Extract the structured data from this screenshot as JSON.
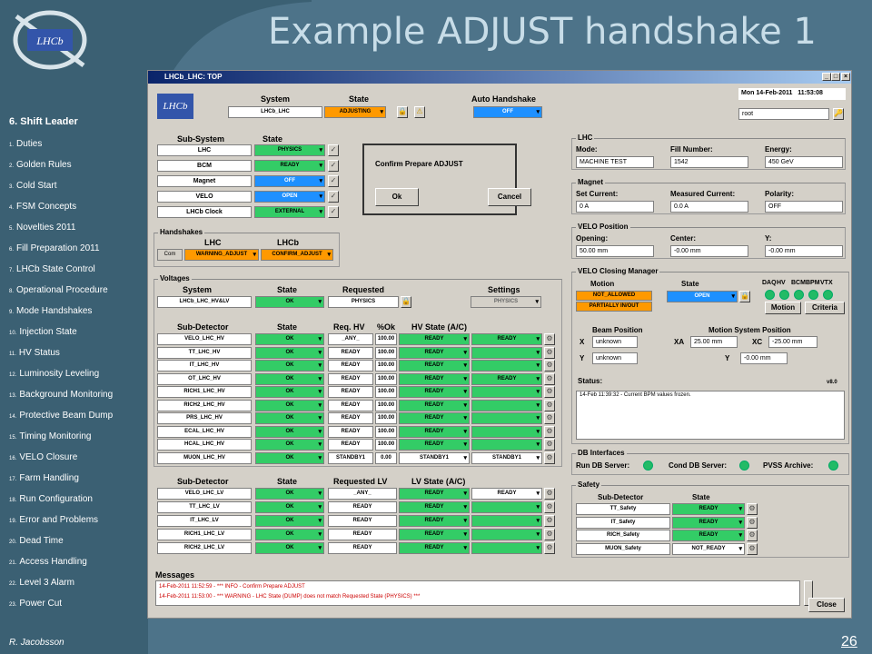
{
  "slide": {
    "title": "Example ADJUST handshake 1",
    "author": "R. Jacobsson",
    "page": "26"
  },
  "sidebar": {
    "title": "6. Shift Leader",
    "items": [
      {
        "num": "1.",
        "label": "Duties"
      },
      {
        "num": "2.",
        "label": "Golden Rules"
      },
      {
        "num": "3.",
        "label": "Cold Start"
      },
      {
        "num": "4.",
        "label": "FSM Concepts"
      },
      {
        "num": "5.",
        "label": "Novelties 2011"
      },
      {
        "num": "6.",
        "label": "Fill Preparation 2011"
      },
      {
        "num": "7.",
        "label": "LHCb State Control"
      },
      {
        "num": "8.",
        "label": "Operational Procedure"
      },
      {
        "num": "9.",
        "label": "Mode Handshakes"
      },
      {
        "num": "10.",
        "label": "Injection State"
      },
      {
        "num": "11.",
        "label": "HV Status"
      },
      {
        "num": "12.",
        "label": "Luminosity Leveling"
      },
      {
        "num": "13.",
        "label": "Background Monitoring"
      },
      {
        "num": "14.",
        "label": "Protective Beam Dump"
      },
      {
        "num": "15.",
        "label": "Timing Monitoring"
      },
      {
        "num": "16.",
        "label": "VELO Closure"
      },
      {
        "num": "17.",
        "label": "Farm Handling"
      },
      {
        "num": "18.",
        "label": "Run Configuration"
      },
      {
        "num": "19.",
        "label": "Error and Problems"
      },
      {
        "num": "20.",
        "label": "Dead Time"
      },
      {
        "num": "21.",
        "label": "Access Handling"
      },
      {
        "num": "22.",
        "label": "Level 3 Alarm"
      },
      {
        "num": "23.",
        "label": "Power Cut"
      }
    ]
  },
  "window": {
    "title": "LHCb_LHC: TOP",
    "min": "_",
    "max": "□",
    "close": "×"
  },
  "top": {
    "system_h": "System",
    "state_h": "State",
    "auto_h": "Auto Handshake",
    "system": "LHCb_LHC",
    "state": "ADJUSTING",
    "auto": "OFF",
    "date": "Mon 14-Feb-2011",
    "time": "11:53:08",
    "user": "root"
  },
  "subsystem": {
    "h1": "Sub-System",
    "h2": "State",
    "rows": [
      {
        "name": "LHC",
        "state": "PHYSICS"
      },
      {
        "name": "BCM",
        "state": "READY"
      },
      {
        "name": "Magnet",
        "state": "OFF"
      },
      {
        "name": "VELO",
        "state": "OPEN"
      },
      {
        "name": "LHCb Clock",
        "state": "EXTERNAL"
      }
    ]
  },
  "handshakes": {
    "title": "Handshakes",
    "lhc_h": "LHC",
    "lhcb_h": "LHCb",
    "row": "Com",
    "lhc": "WARNING_ADJUST",
    "lhcb": "CONFIRM_ADJUST"
  },
  "dialog": {
    "text": "Confirm Prepare ADJUST",
    "ok": "Ok",
    "cancel": "Cancel"
  },
  "lhc": {
    "title": "LHC",
    "mode_l": "Mode:",
    "fill_l": "Fill Number:",
    "energy_l": "Energy:",
    "mode": "MACHINE TEST",
    "fill": "1542",
    "energy": "450 GeV"
  },
  "magnet": {
    "title": "Magnet",
    "set_l": "Set Current:",
    "meas_l": "Measured Current:",
    "pol_l": "Polarity:",
    "set": "0 A",
    "meas": "0.0 A",
    "pol": "OFF"
  },
  "velopos": {
    "title": "VELO Position",
    "open_l": "Opening:",
    "center_l": "Center:",
    "y_l": "Y:",
    "open": "50.00 mm",
    "center": "-0.00 mm",
    "y": "-0.00 mm"
  },
  "veloclose": {
    "title": "VELO Closing Manager",
    "motion_h": "Motion",
    "state_h": "State",
    "m1": "NOT_ALLOWED",
    "m2": "PARTIALLY IN/OUT",
    "state": "OPEN",
    "leds": [
      "DAQ",
      "HV",
      "BCM",
      "BPM",
      "VTX"
    ],
    "motion_btn": "Motion",
    "criteria_btn": "Criteria",
    "beampos_h": "Beam Position",
    "motionsys_h": "Motion System Position",
    "x_l": "X",
    "y_l": "Y",
    "xa_l": "XA",
    "xc_l": "XC",
    "y2_l": "Y",
    "x": "unknown",
    "y": "unknown",
    "xa": "25.00 mm",
    "xc": "-25.00 mm",
    "y2": "-0.00 mm",
    "status_l": "Status:",
    "version": "v8.0",
    "status_msg": "14-Feb 11:39:32 - Current BPM values frozen."
  },
  "db": {
    "title": "DB Interfaces",
    "run": "Run DB Server:",
    "cond": "Cond DB Server:",
    "pvss": "PVSS Archive:"
  },
  "safety": {
    "title": "Safety",
    "h1": "Sub-Detector",
    "h2": "State",
    "rows": [
      {
        "name": "TT_Safety",
        "state": "READY"
      },
      {
        "name": "IT_Safety",
        "state": "READY"
      },
      {
        "name": "RICH_Safety",
        "state": "READY"
      },
      {
        "name": "MUON_Safety",
        "state": "NOT_READY"
      }
    ]
  },
  "voltages": {
    "title": "Voltages",
    "sys_h": "System",
    "state_h": "State",
    "req_h": "Requested",
    "set_h": "Settings",
    "sys": "LHCb_LHC_HV&LV",
    "state": "OK",
    "req": "PHYSICS",
    "set": "PHYSICS",
    "hv_h": [
      "Sub-Detector",
      "State",
      "Req. HV",
      "%Ok",
      "HV State (A/C)"
    ],
    "hv": [
      {
        "n": "VELO_LHC_HV",
        "s": "OK",
        "r": "_ANY_",
        "p": "100.00",
        "a": "READY",
        "c": "READY"
      },
      {
        "n": "TT_LHC_HV",
        "s": "OK",
        "r": "READY",
        "p": "100.00",
        "a": "READY",
        "c": ""
      },
      {
        "n": "IT_LHC_HV",
        "s": "OK",
        "r": "READY",
        "p": "100.00",
        "a": "READY",
        "c": ""
      },
      {
        "n": "OT_LHC_HV",
        "s": "OK",
        "r": "READY",
        "p": "100.00",
        "a": "READY",
        "c": "READY"
      },
      {
        "n": "RICH1_LHC_HV",
        "s": "OK",
        "r": "READY",
        "p": "100.00",
        "a": "READY",
        "c": ""
      },
      {
        "n": "RICH2_LHC_HV",
        "s": "OK",
        "r": "READY",
        "p": "100.00",
        "a": "READY",
        "c": ""
      },
      {
        "n": "PRS_LHC_HV",
        "s": "OK",
        "r": "READY",
        "p": "100.00",
        "a": "READY",
        "c": ""
      },
      {
        "n": "ECAL_LHC_HV",
        "s": "OK",
        "r": "READY",
        "p": "100.00",
        "a": "READY",
        "c": ""
      },
      {
        "n": "HCAL_LHC_HV",
        "s": "OK",
        "r": "READY",
        "p": "100.00",
        "a": "READY",
        "c": ""
      },
      {
        "n": "MUON_LHC_HV",
        "s": "OK",
        "r": "STANDBY1",
        "p": "0.00",
        "a": "STANDBY1",
        "c": "STANDBY1"
      }
    ],
    "lv_h": [
      "Sub-Detector",
      "State",
      "Requested LV",
      "LV State (A/C)"
    ],
    "lv": [
      {
        "n": "VELO_LHC_LV",
        "s": "OK",
        "r": "_ANY_",
        "a": "READY",
        "c": "READY"
      },
      {
        "n": "TT_LHC_LV",
        "s": "OK",
        "r": "READY",
        "a": "READY",
        "c": ""
      },
      {
        "n": "IT_LHC_LV",
        "s": "OK",
        "r": "READY",
        "a": "READY",
        "c": ""
      },
      {
        "n": "RICH1_LHC_LV",
        "s": "OK",
        "r": "READY",
        "a": "READY",
        "c": ""
      },
      {
        "n": "RICH2_LHC_LV",
        "s": "OK",
        "r": "READY",
        "a": "READY",
        "c": ""
      }
    ]
  },
  "messages": {
    "title": "Messages",
    "close": "Close",
    "lines": [
      "14-Feb-2011 11:52:59 - *** INFO - Confirm Prepare ADJUST",
      "14-Feb-2011 11:53:00 - *** WARNING - LHC State (DUMP) does not match Requested State (PHYSICS) ***"
    ]
  },
  "colors": {
    "green": "#33cc66",
    "blue": "#1e90ff",
    "orange": "#ff9900",
    "bg": "#4d7389"
  }
}
